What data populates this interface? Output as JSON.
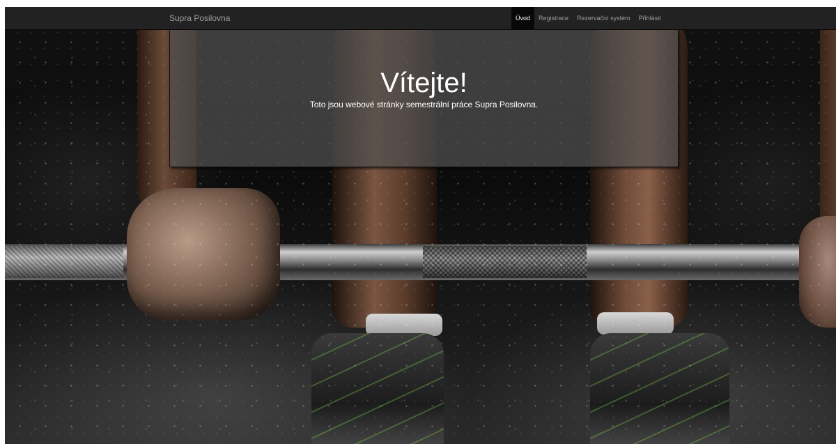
{
  "navbar": {
    "brand": "Supra Posilovna",
    "items": [
      {
        "label": "Úvod",
        "active": true
      },
      {
        "label": "Registrace",
        "active": false
      },
      {
        "label": "Rezervační systém",
        "active": false
      },
      {
        "label": "Přihlásit",
        "active": false
      }
    ]
  },
  "jumbotron": {
    "title": "Vítejte!",
    "text": "Toto jsou webové stránky semestrální práce Supra Posilovna."
  },
  "colors": {
    "navbar_bg": "#222222",
    "nav_active_bg": "#080808",
    "nav_text": "#9d9d9d",
    "jumbotron_bg": "rgba(80,80,80,0.72)"
  },
  "background_image": "weightlifter-barbell-grip-photo"
}
